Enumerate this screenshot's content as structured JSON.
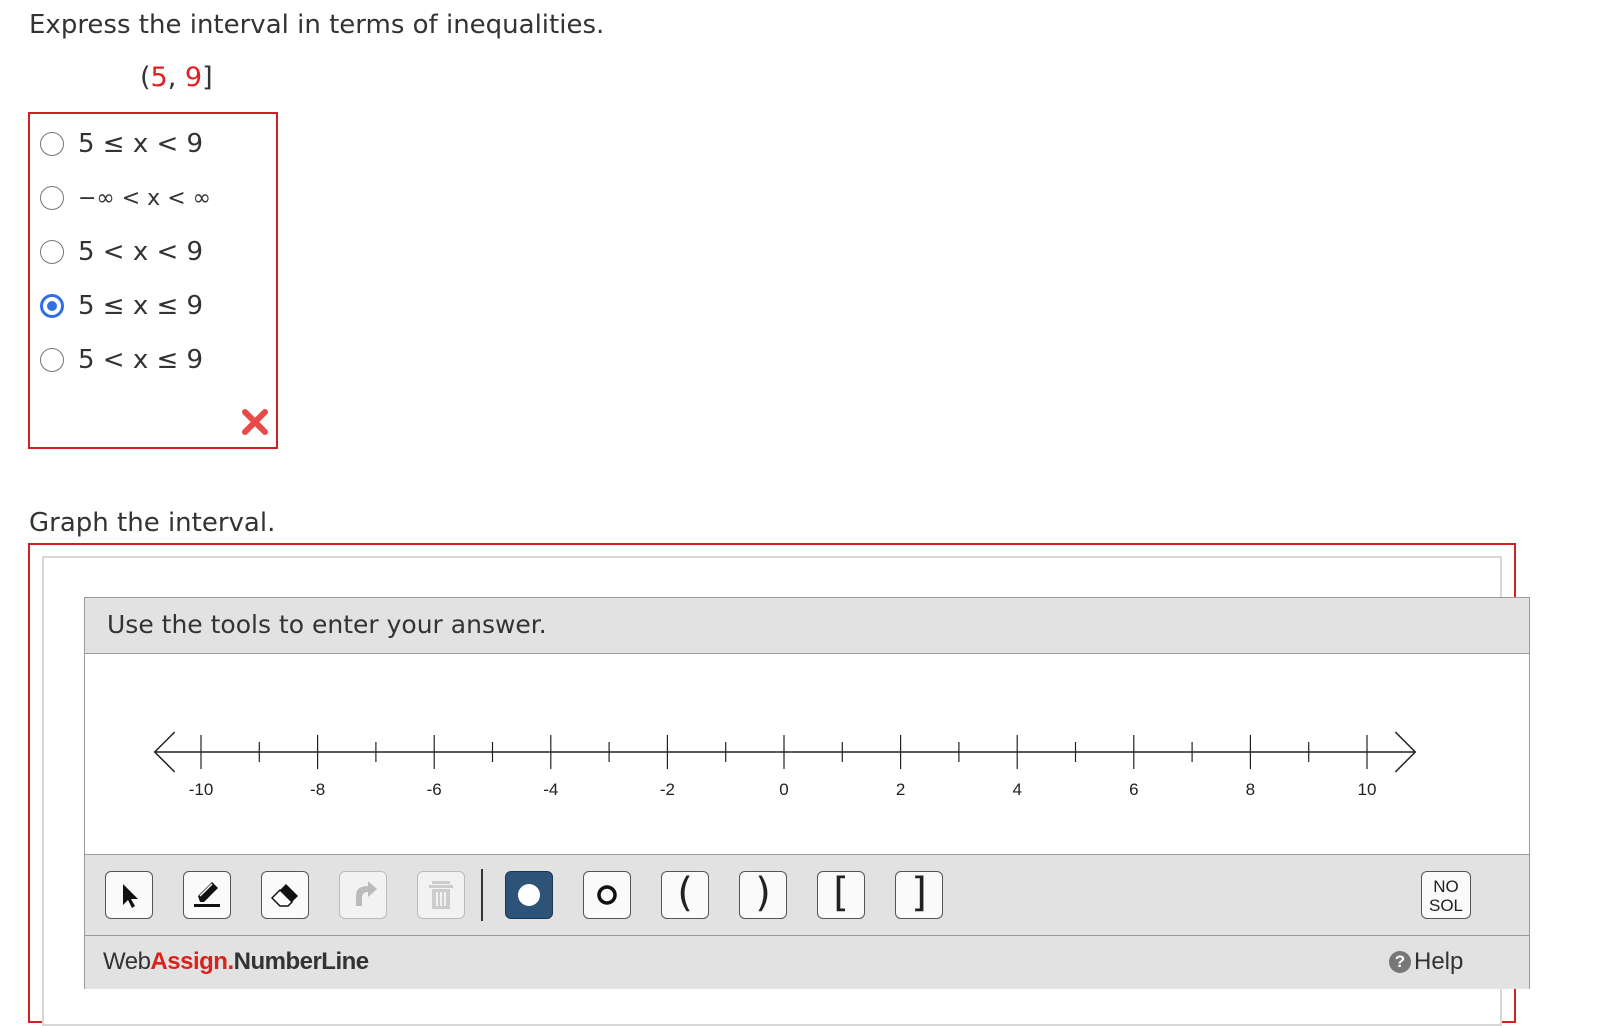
{
  "question1": {
    "prompt": "Express the interval in terms of inequalities.",
    "interval": {
      "open": "(",
      "a": "5",
      "comma": ", ",
      "b": "9",
      "close": "]"
    },
    "choices": [
      {
        "label": "5 ≤ x < 9",
        "selected": false
      },
      {
        "label": "−∞ < x < ∞",
        "selected": false
      },
      {
        "label": "5 < x < 9",
        "selected": false
      },
      {
        "label": "5 ≤ x ≤ 9",
        "selected": true
      },
      {
        "label": "5 < x ≤ 9",
        "selected": false
      }
    ],
    "result_icon": "incorrect-x-icon",
    "accent_error": "#d21f1f",
    "accent_selected": "#2f6fe5"
  },
  "question2": {
    "prompt": "Graph the interval.",
    "tool": {
      "header": "Use the tools to enter your answer.",
      "number_line": {
        "min": -11,
        "max": 11,
        "labels": [
          "-10",
          "-8",
          "-6",
          "-4",
          "-2",
          "0",
          "2",
          "4",
          "6",
          "8",
          "10"
        ]
      },
      "toolbar": {
        "pointer": "pointer-icon",
        "draw": "pencil-icon",
        "erase": "eraser-icon",
        "undo": "undo-icon",
        "delete": "trash-icon",
        "closed_point": "closed-point-icon",
        "open_point": "open-point-icon",
        "left_paren": "(",
        "right_paren": ")",
        "left_bracket": "[",
        "right_bracket": "]",
        "no_solution": {
          "line1": "NO",
          "line2": "SOL"
        }
      },
      "footer": {
        "brand_web": "Web",
        "brand_assign": "Assign",
        "brand_dot": ".",
        "brand_product": "NumberLine",
        "help": "Help"
      }
    }
  }
}
